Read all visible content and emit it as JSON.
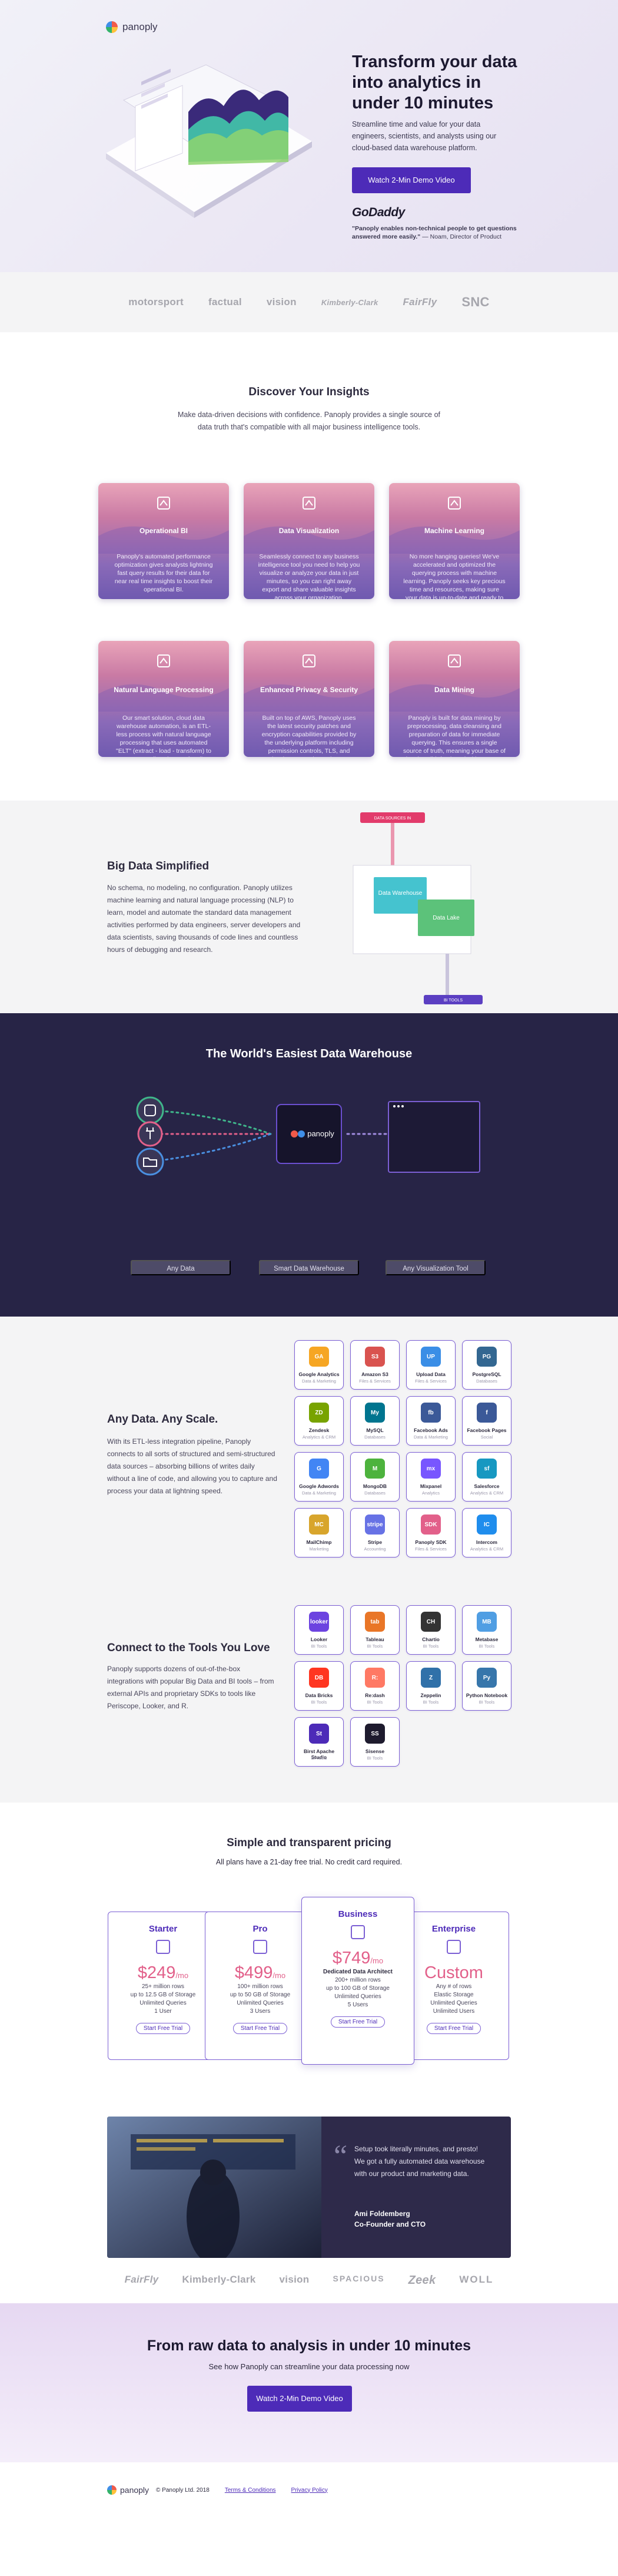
{
  "brand": {
    "name": "panoply"
  },
  "hero": {
    "title": "Transform your data into analytics in under 10 minutes",
    "subtitle": "Streamline time and value for your data engineers, scientists, and analysts using our cloud-based data warehouse platform.",
    "cta": "Watch 2-Min Demo Video",
    "testimonial_logo": "GoDaddy",
    "quote": "\"Panoply enables non-technical people to get questions answered more easily.\"",
    "quote_author": "— Noam, Director of Product"
  },
  "logos": [
    "motorsport",
    "factual",
    "vision",
    "Kimberly-Clark",
    "FairFly",
    "SNC"
  ],
  "discover": {
    "title": "Discover Your Insights",
    "subtitle": "Make data-driven decisions with confidence. Panoply provides a single source of data truth that's compatible with all major business intelligence tools.",
    "cards": [
      {
        "title": "Operational BI",
        "icon": "cubes-icon",
        "text": "Panoply's automated performance optimization gives analysts lightning fast query results for their data for near real time insights to boost their operational BI."
      },
      {
        "title": "Data Visualization",
        "icon": "chart-icon",
        "text": "Seamlessly connect to any business intelligence tool you need to help you visualize or analyze your data in just minutes, so you can right away export and share valuable insights across your organization."
      },
      {
        "title": "Machine Learning",
        "icon": "brain-icon",
        "text": "No more hanging queries! We've accelerated and optimized the querying process with machine learning. Panoply seeks key precious time and resources, making sure your data is up-to-date and ready to be shared."
      },
      {
        "title": "Natural Language Processing",
        "icon": "nodes-icon",
        "text": "Our smart solution, cloud data warehouse automation, is an ETL-less process with natural language processing that uses automated \"ELT\" (extract - load - transform) to save you endless hours of coding and modeling for data ingestion, integration, and transformation."
      },
      {
        "title": "Enhanced Privacy & Security",
        "icon": "shield-icon",
        "text": "Built on top of AWS, Panoply uses the latest security patches and encryption capabilities provided by the underlying platform including permission controls, TLS, and hardware-accelerated RSA encryption."
      },
      {
        "title": "Data Mining",
        "icon": "search-icon",
        "text": "Panoply is built for data mining by preprocessing, data cleansing and preparation of data for immediate querying. This ensures a single source of truth, meaning your base of data is solid, fresh and without errors that could affect the outcomes of your data mining process."
      }
    ]
  },
  "bigdata": {
    "title": "Big Data Simplified",
    "text": "No schema, no modeling, no configuration. Panoply utilizes machine learning and natural language processing (NLP) to learn, model and automate the standard data management activities performed by data engineers, server developers and data scientists, saving thousands of code lines and countless hours of debugging and research.",
    "diagram": {
      "top_tag": "DATA SOURCES IN",
      "box1": "Data Warehouse",
      "box2": "Data Lake",
      "bottom_tag": "BI TOOLS"
    }
  },
  "warehouse": {
    "title": "The World's Easiest Data Warehouse",
    "buttons": [
      "Any Data",
      "Smart Data Warehouse",
      "Any Visualization Tool"
    ],
    "center_label": "panoply"
  },
  "sources": {
    "title": "Any Data. Any Scale.",
    "text": "With its ETL-less integration pipeline, Panoply connects to all sorts of structured and semi-structured data sources – absorbing billions of writes daily without a line of code, and allowing you to capture and process your data at lightning speed.",
    "tiles": [
      {
        "name": "Google Analytics",
        "cat": "Data & Marketing",
        "icon": "GA",
        "color": "#f6a623"
      },
      {
        "name": "Amazon S3",
        "cat": "Files & Services",
        "icon": "S3",
        "color": "#d9534f"
      },
      {
        "name": "Upload Data",
        "cat": "Files & Services",
        "icon": "UP",
        "color": "#3a8ee6"
      },
      {
        "name": "PostgreSQL",
        "cat": "Databases",
        "icon": "PG",
        "color": "#336791"
      },
      {
        "name": "Zendesk",
        "cat": "Analytics & CRM",
        "icon": "ZD",
        "color": "#78a300"
      },
      {
        "name": "MySQL",
        "cat": "Databases",
        "icon": "My",
        "color": "#00758f"
      },
      {
        "name": "Facebook Ads",
        "cat": "Data & Marketing",
        "icon": "fb",
        "color": "#3b5998"
      },
      {
        "name": "Facebook Pages",
        "cat": "Social",
        "icon": "f",
        "color": "#3b5998"
      },
      {
        "name": "Google Adwords",
        "cat": "Data & Marketing",
        "icon": "G",
        "color": "#4285f4"
      },
      {
        "name": "MongoDB",
        "cat": "Databases",
        "icon": "M",
        "color": "#4db33d"
      },
      {
        "name": "Mixpanel",
        "cat": "Analytics",
        "icon": "mx",
        "color": "#7856ff"
      },
      {
        "name": "Salesforce",
        "cat": "Analytics & CRM",
        "icon": "sf",
        "color": "#1798c1"
      },
      {
        "name": "MailChimp",
        "cat": "Marketing",
        "icon": "MC",
        "color": "#d8a52c"
      },
      {
        "name": "Stripe",
        "cat": "Accounting",
        "icon": "stripe",
        "color": "#6772e5"
      },
      {
        "name": "Panoply SDK",
        "cat": "Files & Services",
        "icon": "SDK",
        "color": "#e2608a"
      },
      {
        "name": "Intercom",
        "cat": "Analytics & CRM",
        "icon": "IC",
        "color": "#1f8ded"
      }
    ]
  },
  "tools": {
    "title": "Connect to the Tools You Love",
    "text": "Panoply supports dozens of out-of-the-box integrations with popular Big Data and BI tools – from external APIs and proprietary SDKs to tools like Periscope, Looker, and R.",
    "tiles": [
      {
        "name": "Looker",
        "cat": "BI Tools",
        "icon": "looker",
        "color": "#6c43e0"
      },
      {
        "name": "Tableau",
        "cat": "BI Tools",
        "icon": "tab",
        "color": "#e97627"
      },
      {
        "name": "Chartio",
        "cat": "BI Tools",
        "icon": "CH",
        "color": "#333333"
      },
      {
        "name": "Metabase",
        "cat": "BI Tools",
        "icon": "MB",
        "color": "#509ee3"
      },
      {
        "name": "Data Bricks",
        "cat": "BI Tools",
        "icon": "DB",
        "color": "#ff3621"
      },
      {
        "name": "Re:dash",
        "cat": "BI Tools",
        "icon": "R:",
        "color": "#ff7964"
      },
      {
        "name": "Zeppelin",
        "cat": "BI Tools",
        "icon": "Z",
        "color": "#3071a9"
      },
      {
        "name": "Python Notebook",
        "cat": "BI Tools",
        "icon": "Py",
        "color": "#3776ab"
      },
      {
        "name": "Birst Apache Studio",
        "cat": "BI Tools",
        "icon": "St",
        "color": "#4d2bb8"
      },
      {
        "name": "Sisense",
        "cat": "BI Tools",
        "icon": "SS",
        "color": "#1e1b2e"
      }
    ]
  },
  "pricing": {
    "title": "Simple and transparent pricing",
    "subtitle": "All plans have a 21-day free trial. No credit card required.",
    "plans": [
      {
        "name": "Starter",
        "price": "$249",
        "per": "/mo",
        "lines": [
          "25+ million rows",
          "up to 12.5 GB of Storage",
          "Unlimited Queries",
          "1 User"
        ],
        "button": "Start Free Trial"
      },
      {
        "name": "Pro",
        "price": "$499",
        "per": "/mo",
        "lines": [
          "100+ million rows",
          "up to 50 GB of Storage",
          "Unlimited Queries",
          "3 Users"
        ],
        "button": "Start Free Trial"
      },
      {
        "name": "Business",
        "price": "$749",
        "per": "/mo",
        "lines": [
          "Dedicated Data Architect",
          "200+ million rows",
          "up to 100 GB of Storage",
          "Unlimited Queries",
          "5 Users"
        ],
        "button": "Start Free Trial"
      },
      {
        "name": "Enterprise",
        "price": "Custom",
        "per": "",
        "lines": [
          "Any # of rows",
          "Elastic Storage",
          "Unlimited Queries",
          "Unlimited Users"
        ],
        "button": "Start Free Trial"
      }
    ]
  },
  "testimonial": {
    "quote": "Setup took literally minutes, and presto! We got a fully automated data warehouse with our product and marketing data.",
    "name": "Ami Foldemberg",
    "role": "Co-Founder and CTO"
  },
  "logos2": [
    "FairFly",
    "Kimberly-Clark",
    "vision",
    "SPACIOUS",
    "Zeek",
    "WOLL"
  ],
  "cta": {
    "title": "From raw data to analysis in under 10 minutes",
    "subtitle": "See how Panoply can streamline your data processing now",
    "button": "Watch 2-Min Demo Video"
  },
  "footer": {
    "copyright": "© Panoply Ltd. 2018",
    "terms": "Terms & Conditions",
    "privacy": "Privacy Policy"
  }
}
